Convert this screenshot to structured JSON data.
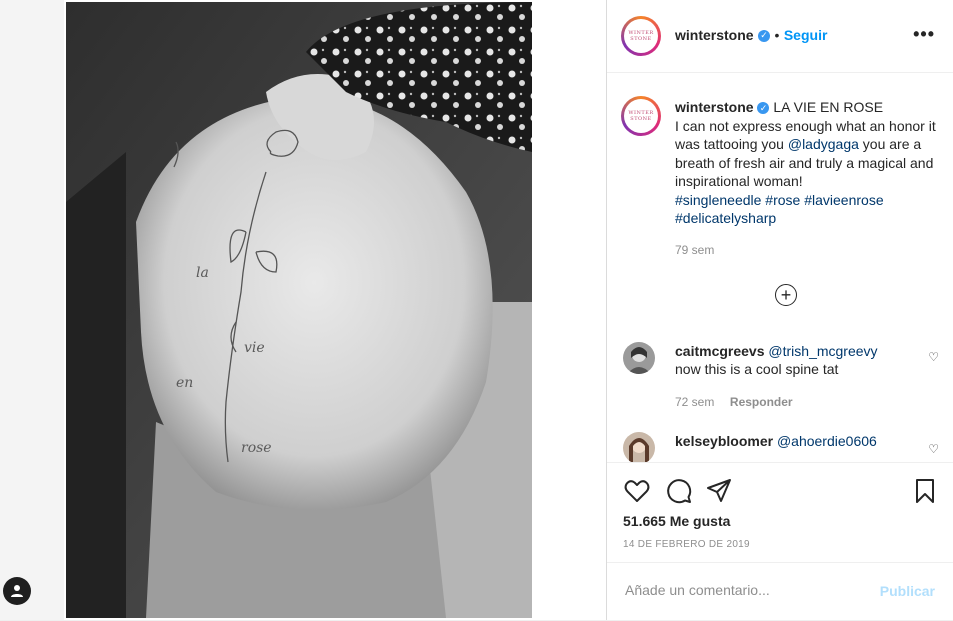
{
  "post": {
    "account": {
      "username": "winterstone",
      "avatar_text_top": "WINTER",
      "avatar_text_bottom": "STONE",
      "follow_label": "Seguir",
      "separator": "•"
    },
    "caption": {
      "username": "winterstone",
      "title": "LA VIE EN ROSE",
      "text_part1": "I can not express enough what an honor it was tattooing you ",
      "mention": "@ladygaga",
      "text_part2": " you are a breath of fresh air and truly a magical and inspirational woman!",
      "hashtags": [
        "#singleneedle",
        "#rose",
        "#lavieenrose",
        "#delicatelysharp"
      ],
      "time": "79 sem"
    },
    "comments": [
      {
        "username": "caitmcgreevs",
        "mention": "@trish_mcgreevy",
        "text": "now this is a cool spine tat",
        "time": "72 sem",
        "reply_label": "Responder"
      },
      {
        "username": "kelseybloomer",
        "mention": "@ahoerdie0606"
      }
    ],
    "likes": "51.665 Me gusta",
    "date": "14 DE FEBRERO DE 2019",
    "comment_placeholder": "Añade un comentario...",
    "publish_label": "Publicar"
  },
  "icons": {
    "more": "more-options-icon",
    "load_more": "plus-circle-icon",
    "like": "heart-icon",
    "comment": "comment-icon",
    "share": "paper-plane-icon",
    "save": "bookmark-icon",
    "verified": "verified-badge-icon",
    "user": "user-icon"
  },
  "colors": {
    "accent": "#0095f6",
    "link": "#00376b",
    "muted": "#8e8e8e",
    "publish_disabled": "#b2dffc"
  }
}
